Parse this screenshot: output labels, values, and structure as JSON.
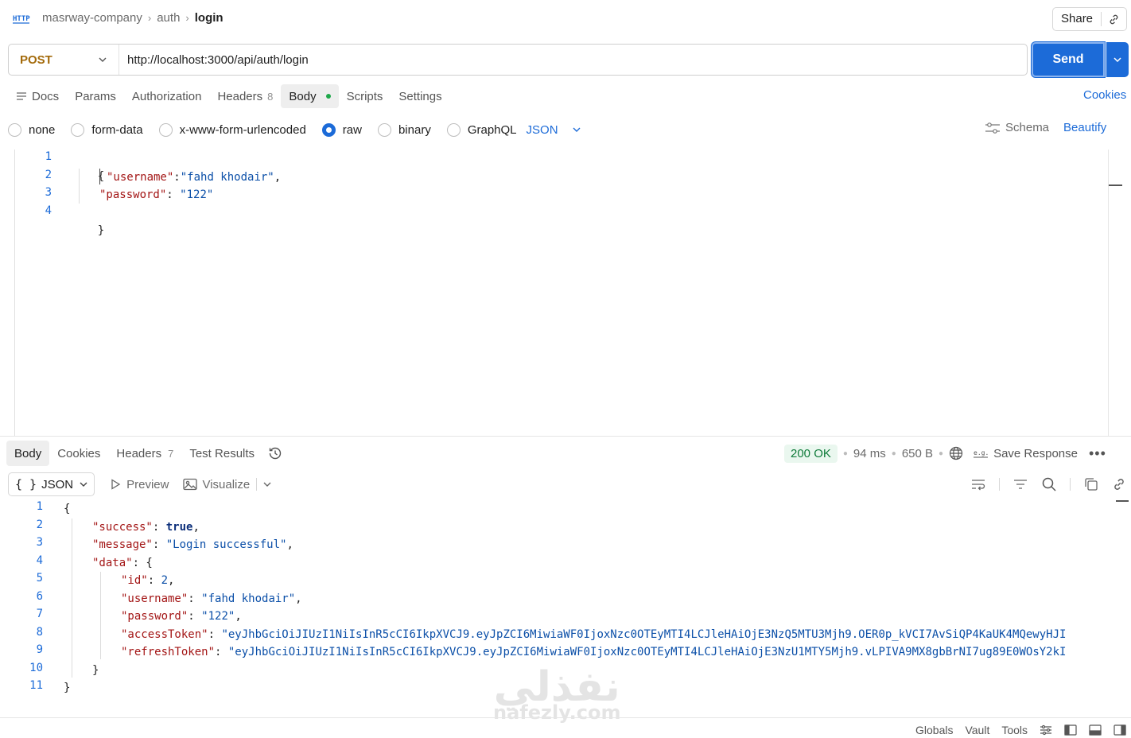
{
  "breadcrumb": {
    "workspace": "masrway-company",
    "folder": "auth",
    "request": "login",
    "icon": "http-icon"
  },
  "share": {
    "label": "Share"
  },
  "request": {
    "method": "POST",
    "url": "http://localhost:3000/api/auth/login",
    "send_label": "Send"
  },
  "request_tabs": [
    {
      "label": "Docs"
    },
    {
      "label": "Params"
    },
    {
      "label": "Authorization"
    },
    {
      "label": "Headers",
      "count": "8"
    },
    {
      "label": "Body",
      "active": true
    },
    {
      "label": "Scripts"
    },
    {
      "label": "Settings"
    }
  ],
  "cookies_link": "Cookies",
  "body_types": [
    {
      "label": "none"
    },
    {
      "label": "form-data"
    },
    {
      "label": "x-www-form-urlencoded"
    },
    {
      "label": "raw",
      "checked": true
    },
    {
      "label": "binary"
    },
    {
      "label": "GraphQL"
    }
  ],
  "body_language": "JSON",
  "schema_label": "Schema",
  "beautify_label": "Beautify",
  "request_body": {
    "line_numbers": [
      "1",
      "2",
      "3",
      "4"
    ],
    "open_brace": "{",
    "close_brace": "}",
    "username_key": "\"username\"",
    "username_value": "\"fahd khodair\"",
    "password_key": "\"password\"",
    "password_value": "\"122\""
  },
  "response_tabs": [
    {
      "label": "Body",
      "active": true
    },
    {
      "label": "Cookies"
    },
    {
      "label": "Headers",
      "count": "7"
    },
    {
      "label": "Test Results"
    }
  ],
  "response_meta": {
    "status": "200 OK",
    "time": "94 ms",
    "size": "650 B",
    "save_label": "Save Response",
    "status_color": "#0f7b3a"
  },
  "response_toolbar": {
    "format": "JSON",
    "preview": "Preview",
    "visualize": "Visualize"
  },
  "response_body": {
    "line_numbers": [
      "1",
      "2",
      "3",
      "4",
      "5",
      "6",
      "7",
      "8",
      "9",
      "10",
      "11"
    ],
    "success_key": "\"success\"",
    "success_value": "true",
    "message_key": "\"message\"",
    "message_value": "\"Login successful\"",
    "data_key": "\"data\"",
    "id_key": "\"id\"",
    "id_value": "2",
    "username_key": "\"username\"",
    "username_value": "\"fahd khodair\"",
    "password_key": "\"password\"",
    "password_value": "\"122\"",
    "access_key": "\"accessToken\"",
    "access_value": "\"eyJhbGciOiJIUzI1NiIsInR5cCI6IkpXVCJ9.eyJpZCI6MiwiaWF0IjoxNzc0OTEyMTI4LCJleHAiOjE3NzQ5MTU3Mjh9.OER0p_kVCI7AvSiQP4KaUK4MQewyHJI",
    "refresh_key": "\"refreshToken\"",
    "refresh_value": "\"eyJhbGciOiJIUzI1NiIsInR5cCI6IkpXVCJ9.eyJpZCI6MiwiaWF0IjoxNzc0OTEyMTI4LCJleHAiOjE3NzU1MTY5Mjh9.vLPIVA9MX8gbBrNI7ug89E0WOsY2kI"
  },
  "watermark": {
    "arabic": "نفذلي",
    "latin": "nafezly.com"
  },
  "footer": {
    "globals": "Globals",
    "vault": "Vault",
    "tools": "Tools"
  },
  "colors": {
    "accent": "#1c6bd8",
    "method": "#a36a0a",
    "json_key": "#a31515",
    "json_string": "#0b4fa8"
  }
}
